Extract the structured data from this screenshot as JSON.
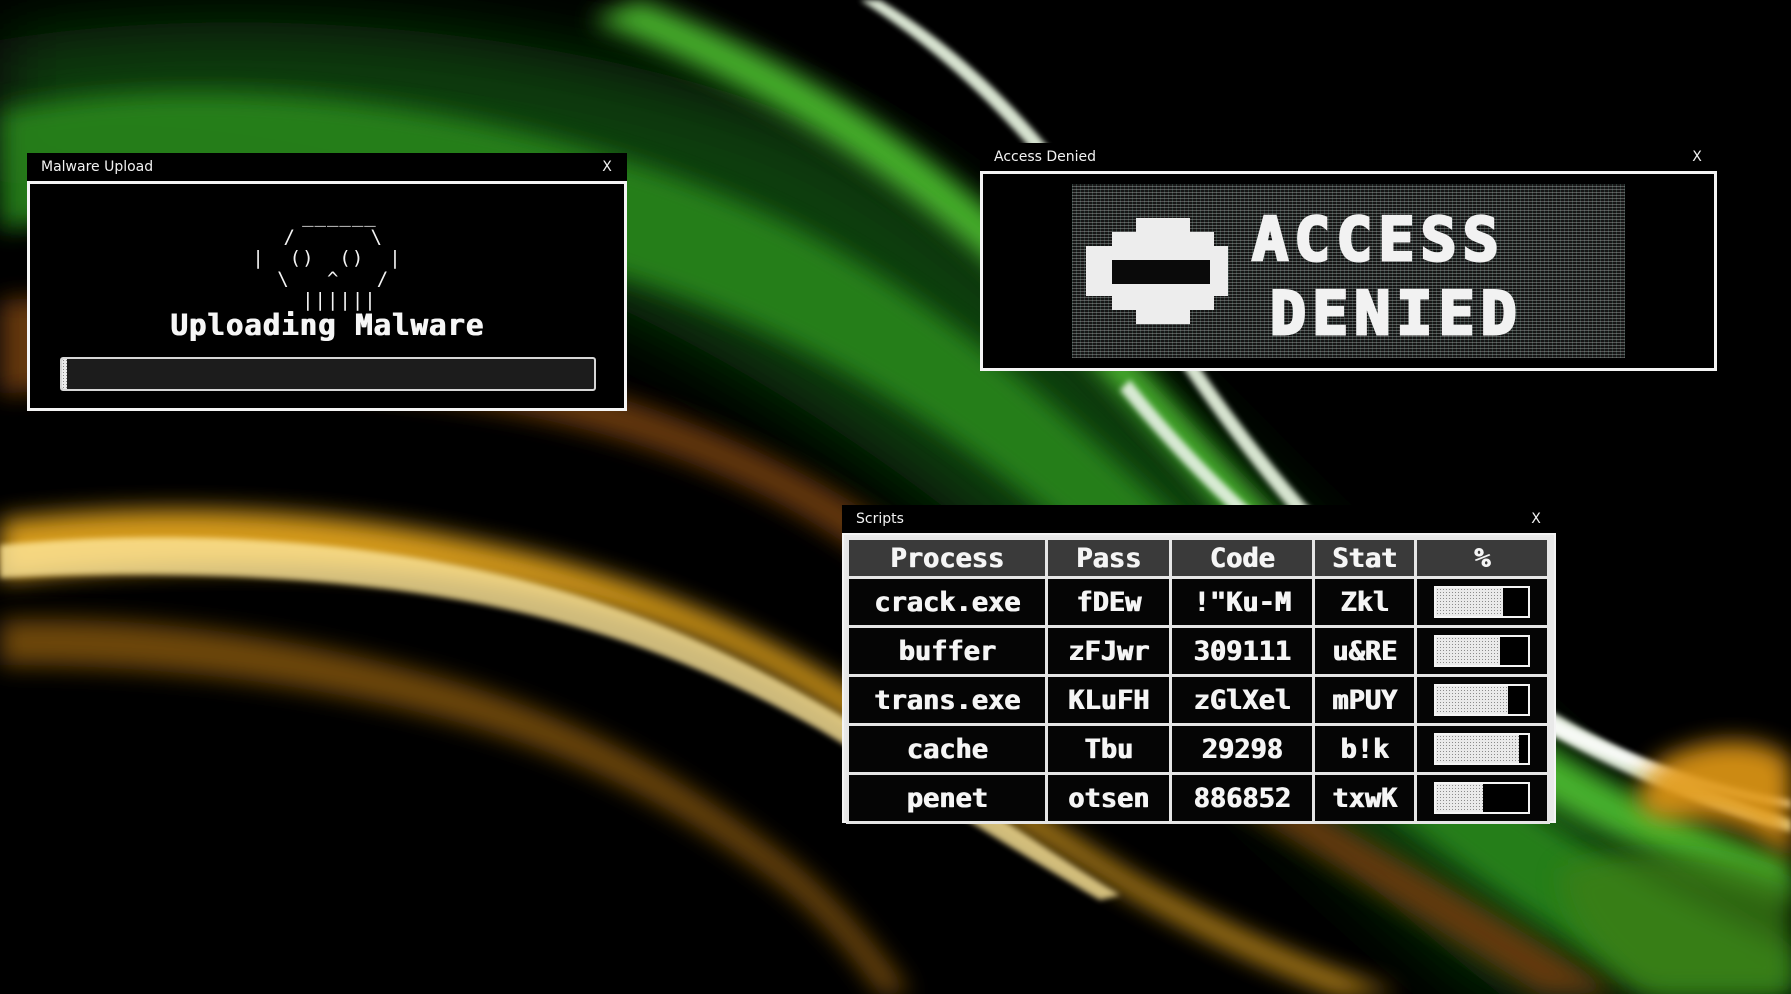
{
  "colors": {
    "window_background": "#000000",
    "window_border": "#f4f4f4",
    "text": "#f5f5f5",
    "table_header_background": "#3a3a3a",
    "table_grid": "#e6e6e6",
    "wallpaper_green": "#3fae2a",
    "wallpaper_yellow": "#e0a21c"
  },
  "windows": {
    "malware": {
      "title": "Malware Upload",
      "close_label": "X",
      "skull_art": "  ______\n /      \\\n|  ()  ()  |\n \\   ^   /\n  ||||||",
      "status_label": "Uploading Malware",
      "progress": 0.01
    },
    "denied": {
      "title": "Access Denied",
      "close_label": "X",
      "banner_line1": "ACCESS",
      "banner_line2": "DENIED",
      "icon": "no-entry-icon"
    },
    "scripts": {
      "title": "Scripts",
      "close_label": "X",
      "columns": [
        "Process",
        "Pass",
        "Code",
        "Stat",
        "%"
      ],
      "rows": [
        {
          "process": "crack.exe",
          "pass": "fDEw",
          "code": "!\"Ku-M",
          "stat": "Zkl",
          "progress": 0.73
        },
        {
          "process": "buffer",
          "pass": "zFJwr",
          "code": "309111",
          "stat": "u&RE",
          "progress": 0.7
        },
        {
          "process": "trans.exe",
          "pass": "KLuFH",
          "code": "zGlXel",
          "stat": "mPUY",
          "progress": 0.78
        },
        {
          "process": "cache",
          "pass": "Tbu",
          "code": "29298",
          "stat": "b!k",
          "progress": 0.9
        },
        {
          "process": "penet",
          "pass": "otsen",
          "code": "886852",
          "stat": "txwK",
          "progress": 0.51
        }
      ]
    }
  }
}
